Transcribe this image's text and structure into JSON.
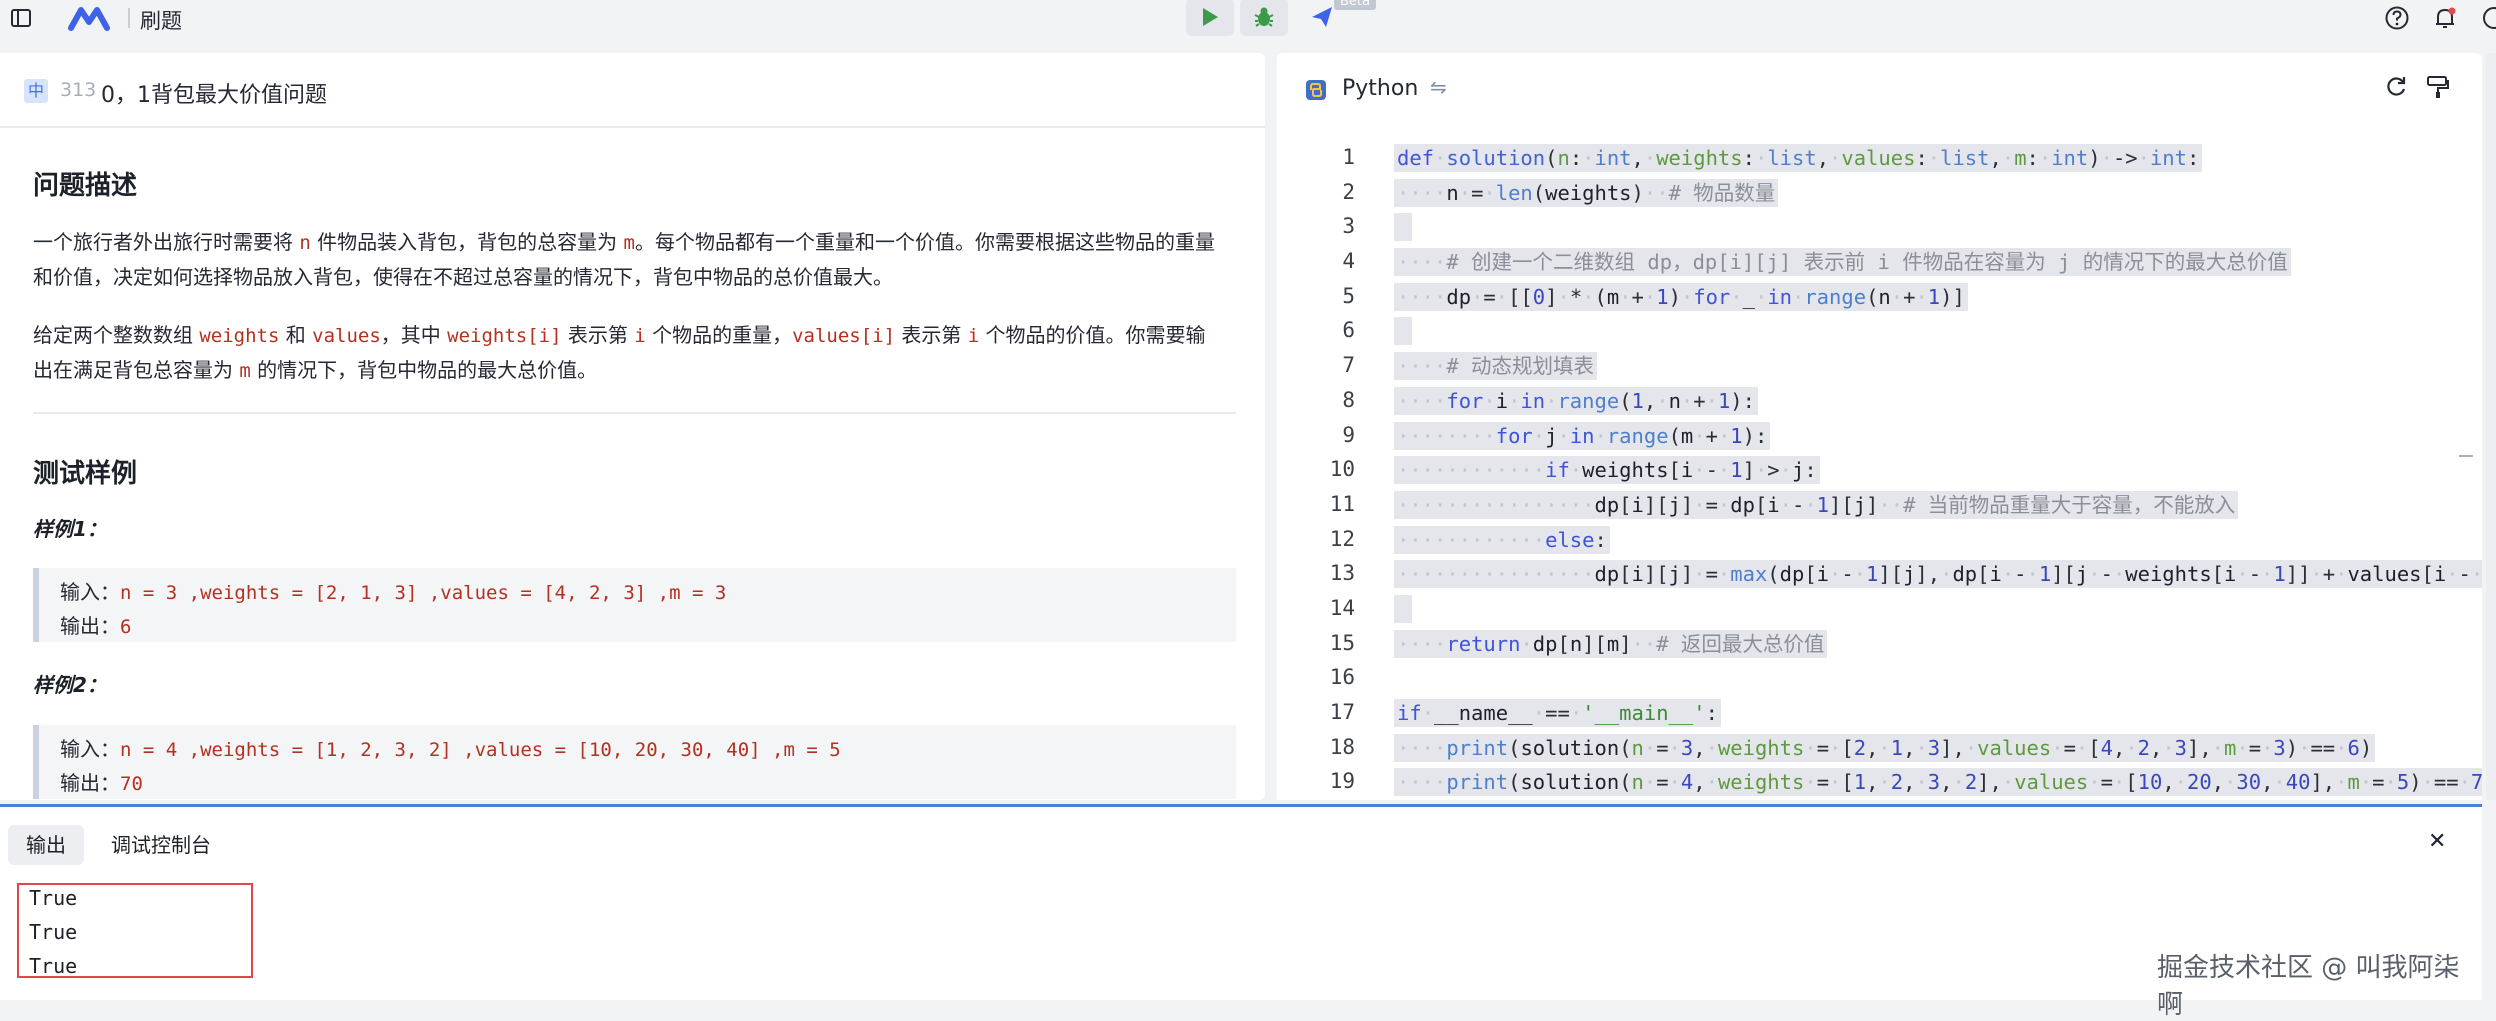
{
  "topbar": {
    "title": "刷题",
    "beta": "Beta"
  },
  "question": {
    "difficulty": "中",
    "number": "313",
    "title": "0，1背包最大价值问题",
    "desc_heading": "问题描述",
    "p1": {
      "a": "一个旅行者外出旅行时需要将 ",
      "n": "n",
      "b": " 件物品装入背包，背包的总容量为 ",
      "m": "m",
      "c": "。每个物品都有一个重量和一个价值。你需要根据这些物品的重量",
      "line2": "和价值，决定如何选择物品放入背包，使得在不超过总容量的情况下，背包中物品的总价值最大。"
    },
    "p2": {
      "a": "给定两个整数数组 ",
      "weights": "weights",
      "b": " 和 ",
      "values": "values",
      "c": "，其中 ",
      "wi": "weights[i]",
      "d": " 表示第 ",
      "i1": "i",
      "e": " 个物品的重量，",
      "vi": "values[i]",
      "f": " 表示第 ",
      "i2": "i",
      "g": " 个物品的价值。你需要输",
      "h": "出在满足背包总容量为 ",
      "m": "m",
      "k": " 的情况下，背包中物品的最大总价值。"
    },
    "examples_heading": "测试样例",
    "examples": [
      {
        "label": "样例1：",
        "input_label": "输入：",
        "input": "n = 3 ,weights = [2, 1, 3] ,values = [4, 2, 3] ,m = 3",
        "output_label": "输出：",
        "output": "6"
      },
      {
        "label": "样例2：",
        "input_label": "输入：",
        "input": "n = 4 ,weights = [1, 2, 3, 2] ,values = [10, 20, 30, 40] ,m = 5",
        "output_label": "输出：",
        "output": "70"
      }
    ]
  },
  "editor": {
    "language": "Python",
    "line_numbers": [
      "1",
      "2",
      "3",
      "4",
      "5",
      "6",
      "7",
      "8",
      "9",
      "10",
      "11",
      "12",
      "13",
      "14",
      "15",
      "16",
      "17",
      "18",
      "19"
    ]
  },
  "bottom": {
    "tab_output": "输出",
    "tab_debug": "调试控制台",
    "output_lines": [
      "True",
      "True",
      "True"
    ],
    "watermark": "掘金技术社区 @ 叫我阿柒啊"
  }
}
